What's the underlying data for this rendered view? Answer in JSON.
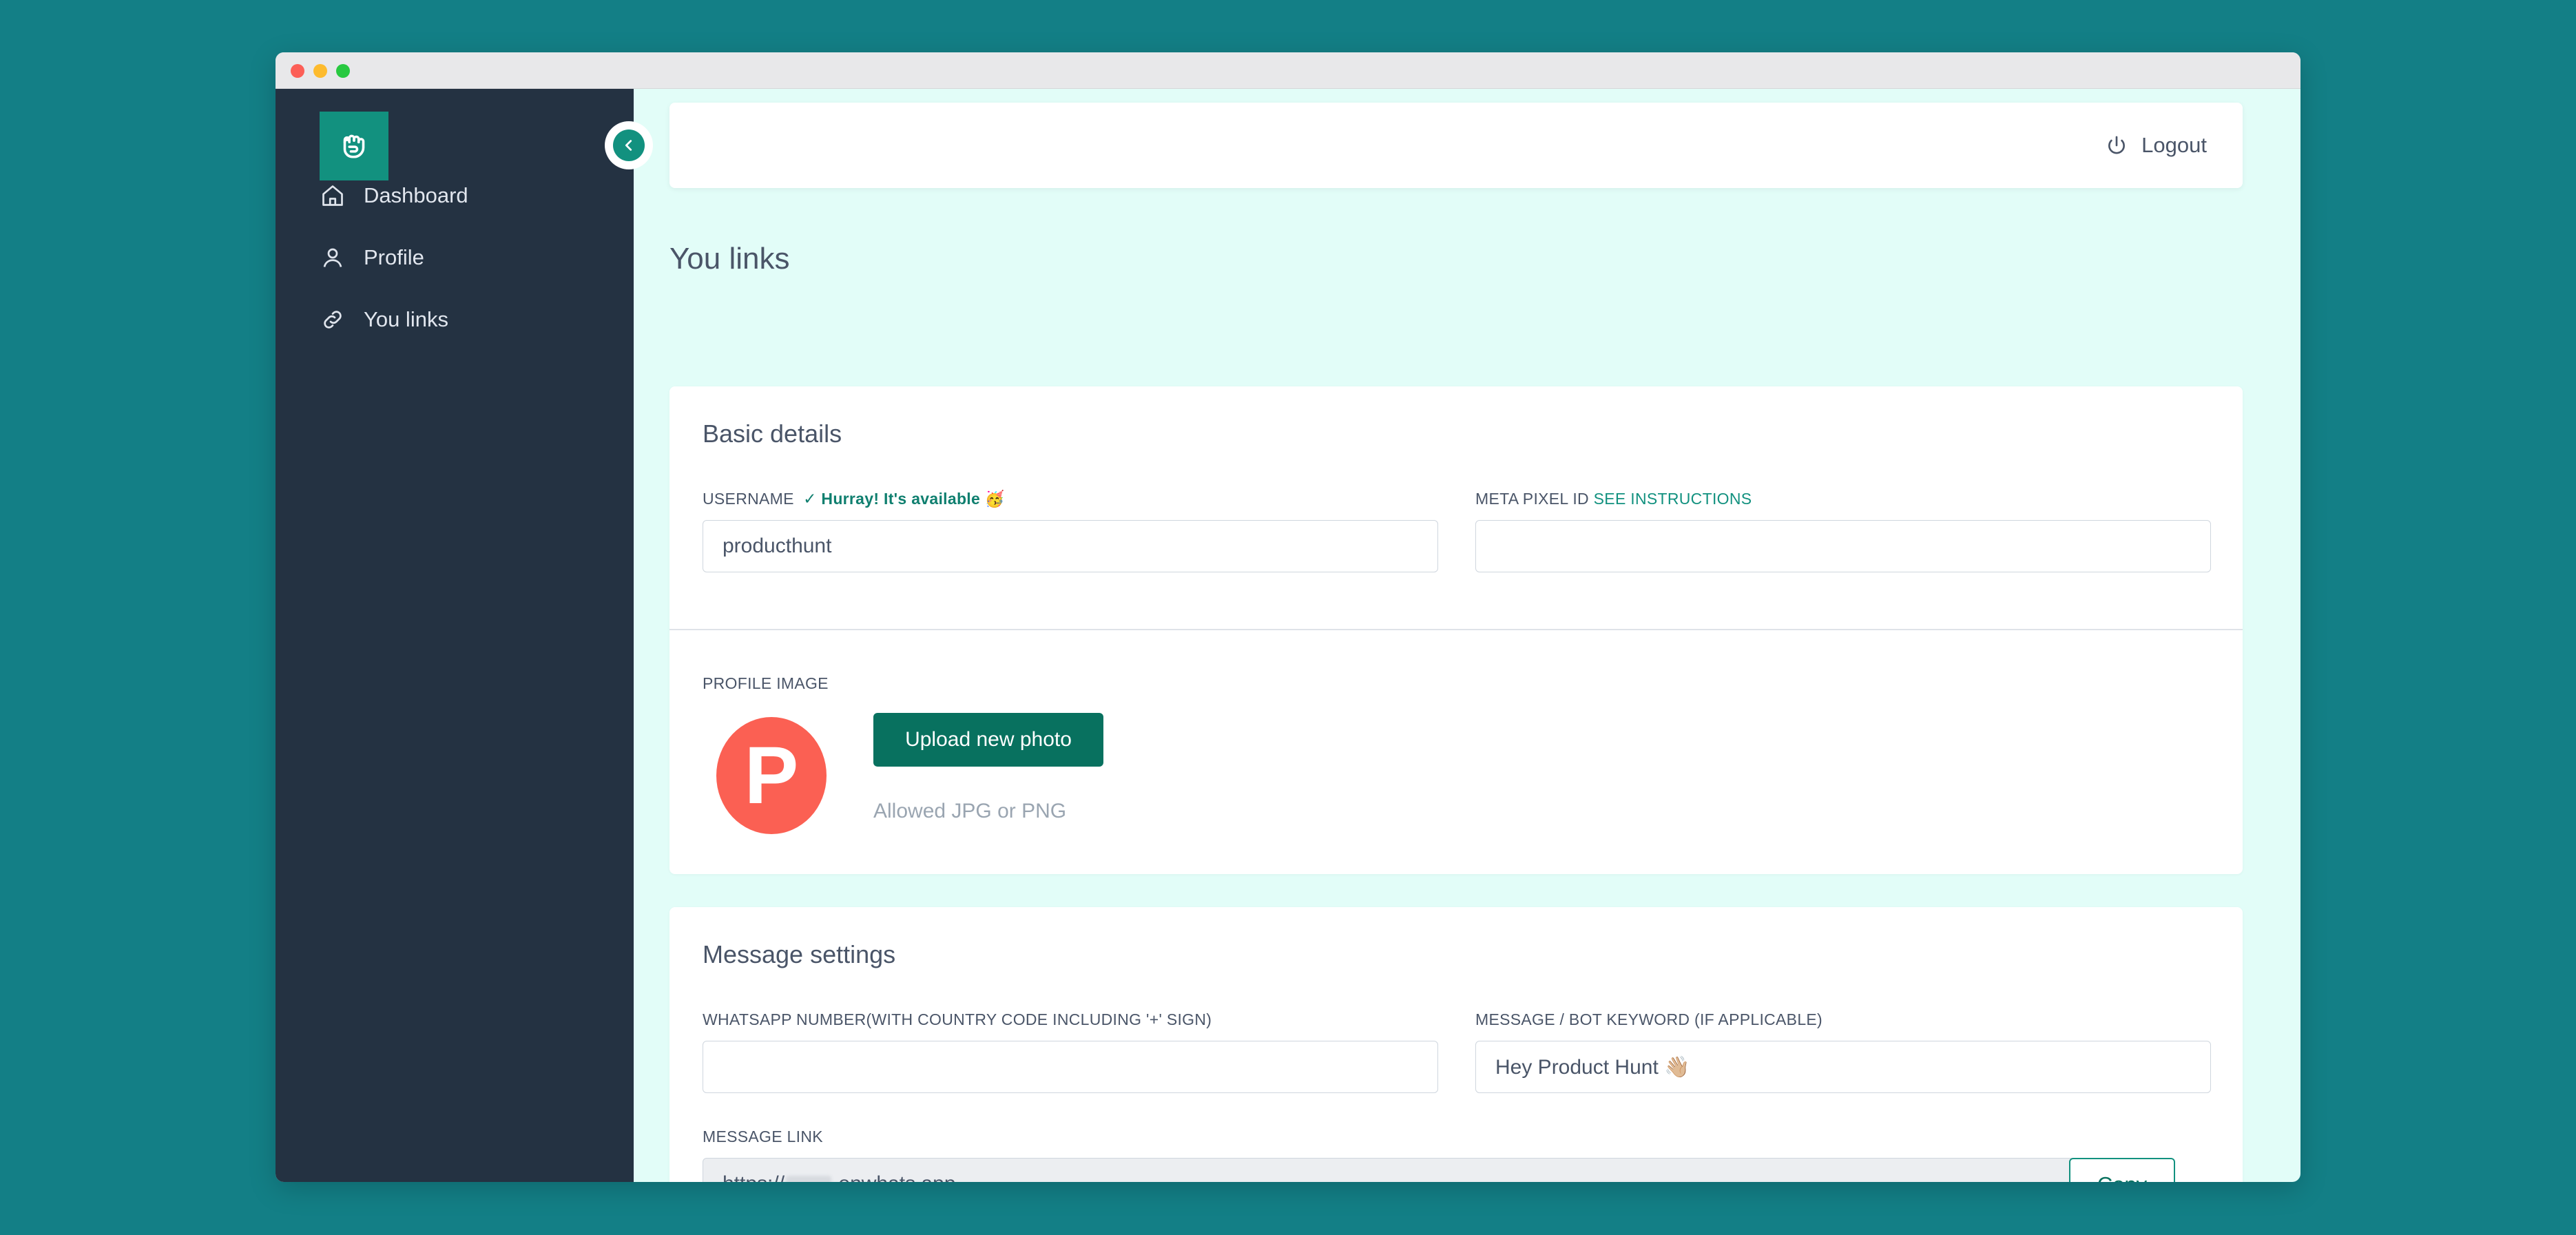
{
  "sidebar": {
    "items": [
      {
        "label": "Dashboard",
        "icon": "home-icon"
      },
      {
        "label": "Profile",
        "icon": "user-icon"
      },
      {
        "label": "You links",
        "icon": "link-icon"
      }
    ]
  },
  "header": {
    "logout_label": "Logout"
  },
  "page": {
    "title": "You links"
  },
  "basic": {
    "title": "Basic details",
    "username_label": "USERNAME",
    "username_status": "✓ Hurray! It's available 🥳",
    "username_value": "producthunt",
    "pixel_label": "META PIXEL ID",
    "pixel_link": "SEE INSTRUCTIONS",
    "pixel_value": "",
    "profile_image_label": "PROFILE IMAGE",
    "avatar_letter": "P",
    "upload_label": "Upload new photo",
    "upload_hint": "Allowed JPG or PNG"
  },
  "message": {
    "title": "Message settings",
    "whatsapp_label": "WHATSAPP NUMBER(WITH COUNTRY CODE INCLUDING '+' SIGN)",
    "whatsapp_value": "",
    "keyword_label": "MESSAGE / BOT KEYWORD (IF APPLICABLE)",
    "keyword_value": "Hey Product Hunt 👋🏼",
    "link_label": "MESSAGE LINK",
    "link_prefix": "https://",
    "link_suffix": ".onwhats.app",
    "copy_label": "Copy"
  },
  "colors": {
    "background": "#137f86",
    "sidebar": "#243242",
    "accent": "#12917f",
    "button": "#08715f",
    "avatar": "#fb6053",
    "content_bg": "#e2fdf8"
  }
}
